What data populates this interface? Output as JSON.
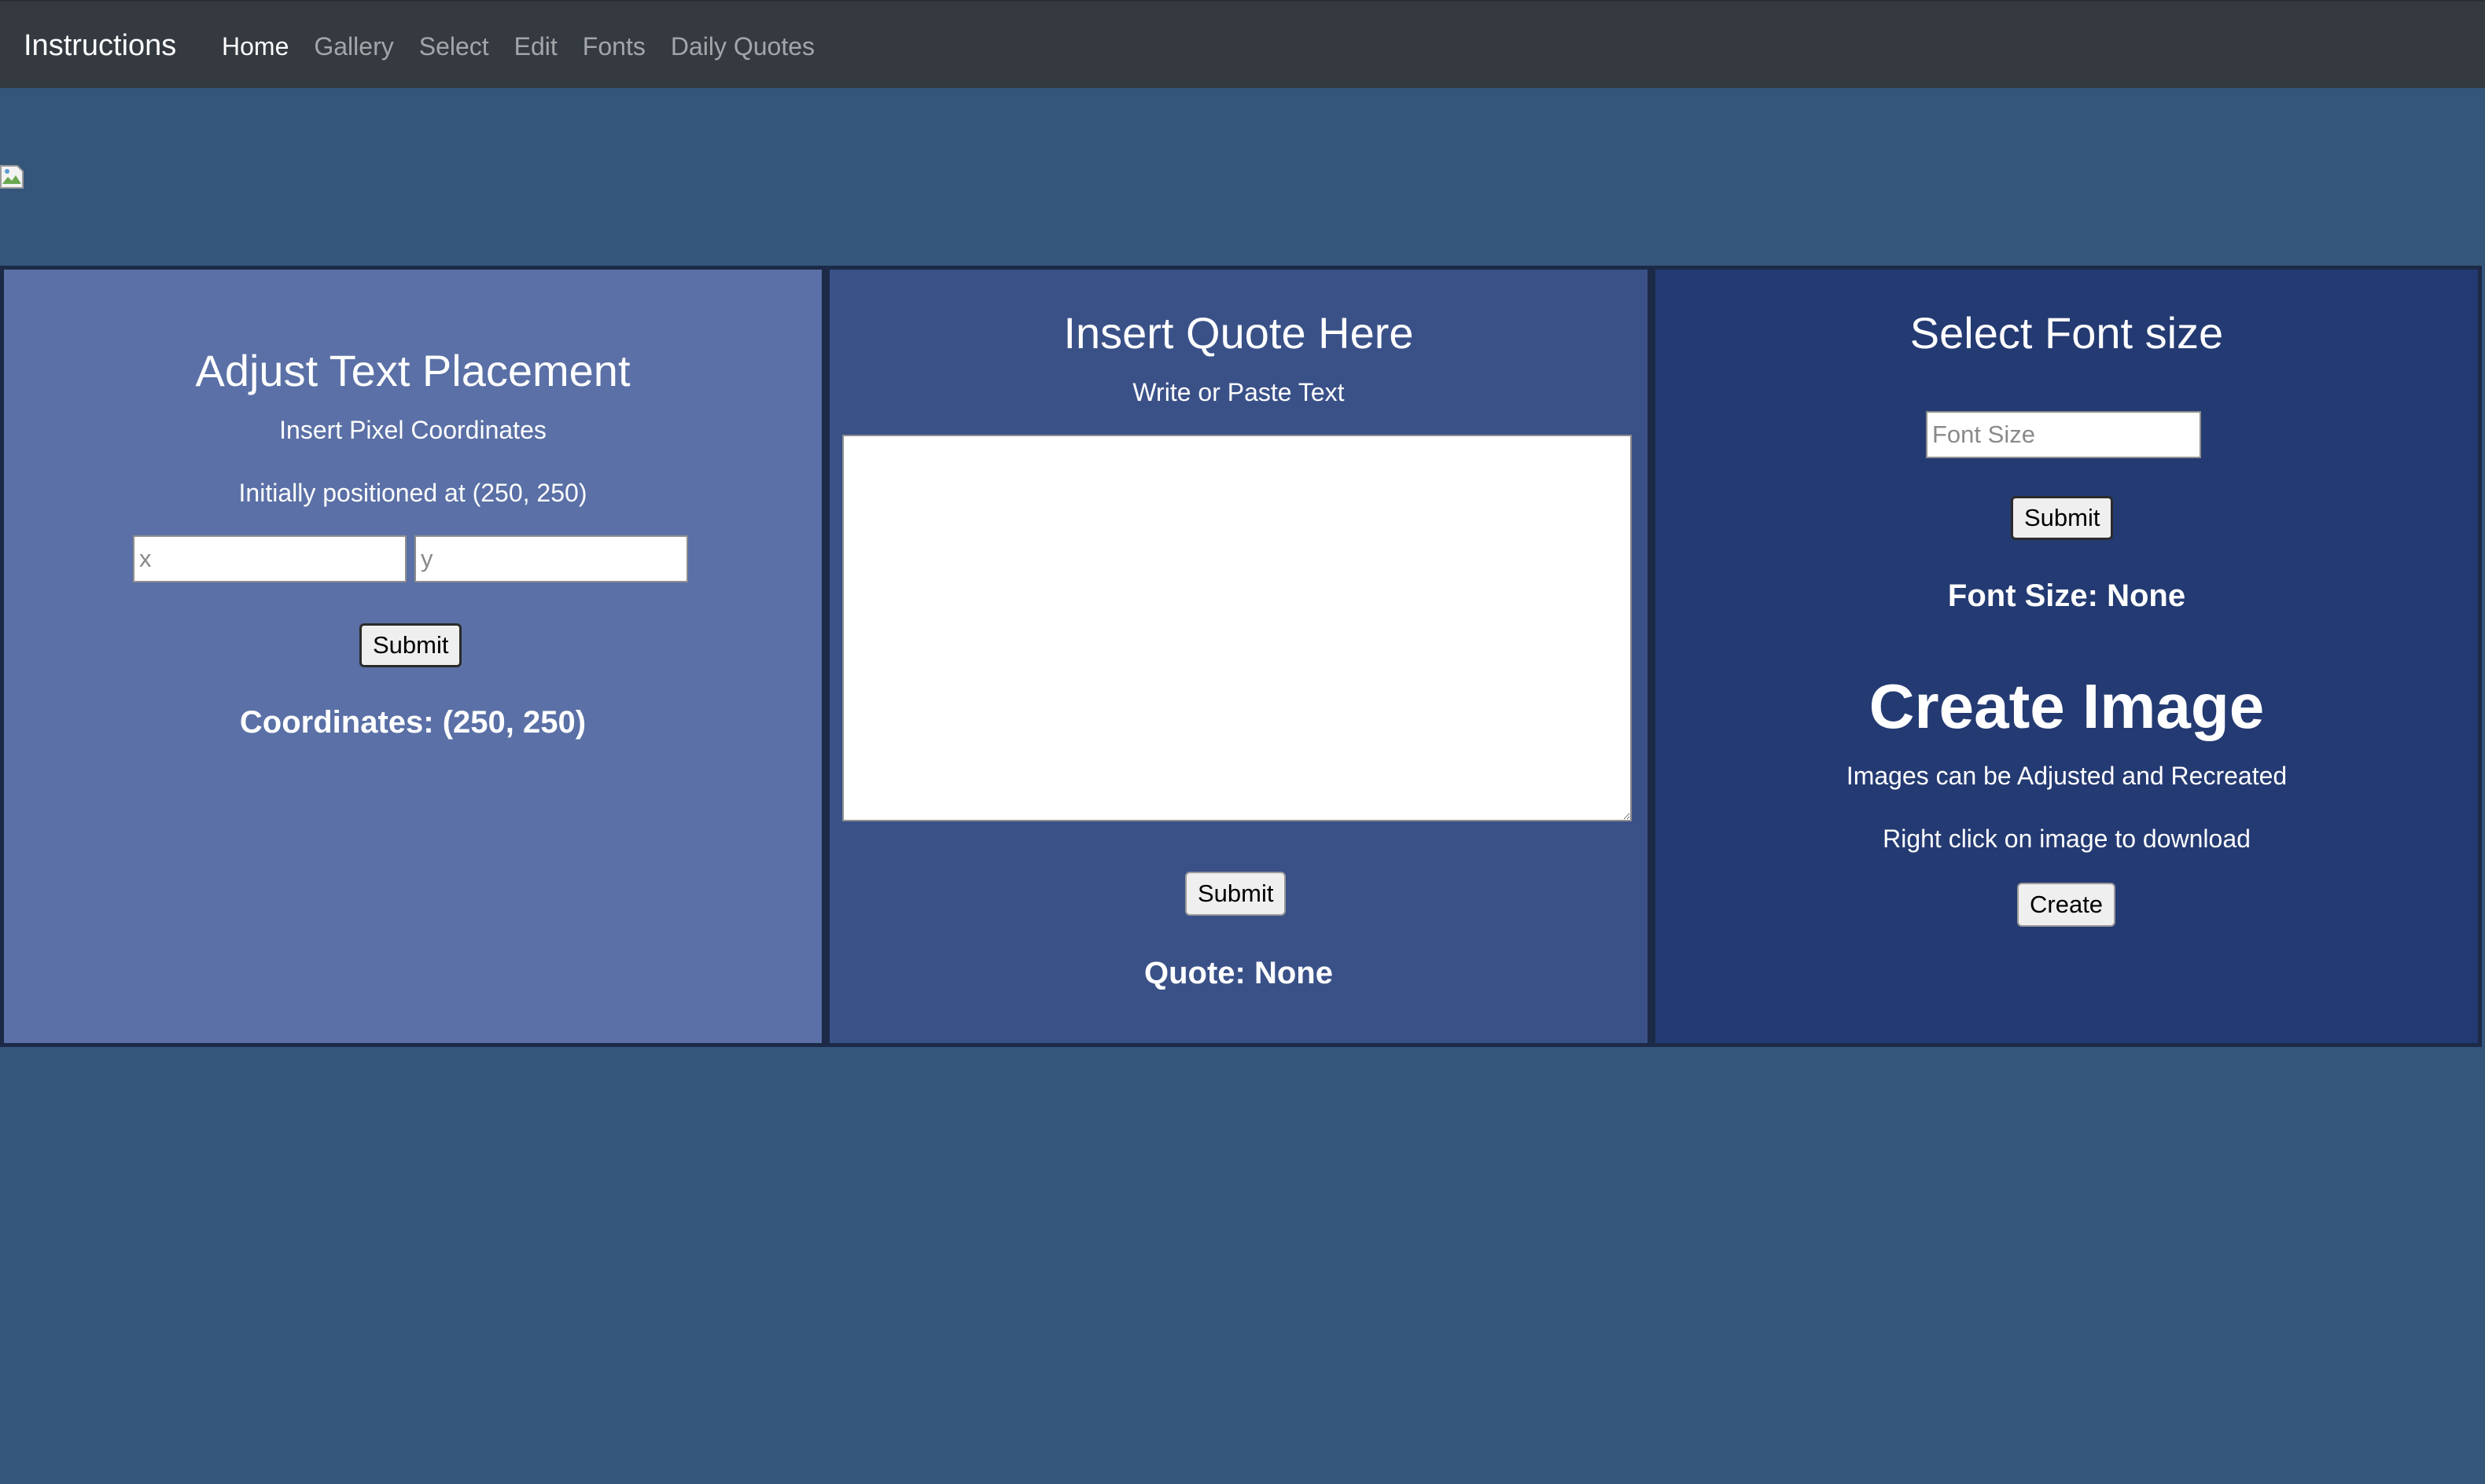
{
  "navbar": {
    "brand": "Instructions",
    "links": [
      "Home",
      "Gallery",
      "Select",
      "Edit",
      "Fonts",
      "Daily Quotes"
    ],
    "active_index": 0
  },
  "placement": {
    "title": "Adjust Text Placement",
    "subtitle": "Insert Pixel Coordinates",
    "initial_note": "Initially positioned at (250, 250)",
    "x_placeholder": "x",
    "y_placeholder": "y",
    "submit_label": "Submit",
    "result": "Coordinates: (250, 250)"
  },
  "quote": {
    "title": "Insert Quote Here",
    "subtitle": "Write or Paste Text",
    "textarea_value": "",
    "submit_label": "Submit",
    "result": "Quote: None"
  },
  "font": {
    "title": "Select Font size",
    "placeholder": "Font Size",
    "submit_label": "Submit",
    "result": "Font Size: None"
  },
  "create": {
    "title": "Create Image",
    "note1": "Images can be Adjusted and Recreated",
    "note2": "Right click on image to download",
    "button_label": "Create"
  },
  "colors": {
    "page_bg": "#34567a",
    "navbar_bg": "#343a40",
    "panel_left": "#5a70a6",
    "panel_mid": "#3a5188",
    "panel_right": "#243a72"
  }
}
